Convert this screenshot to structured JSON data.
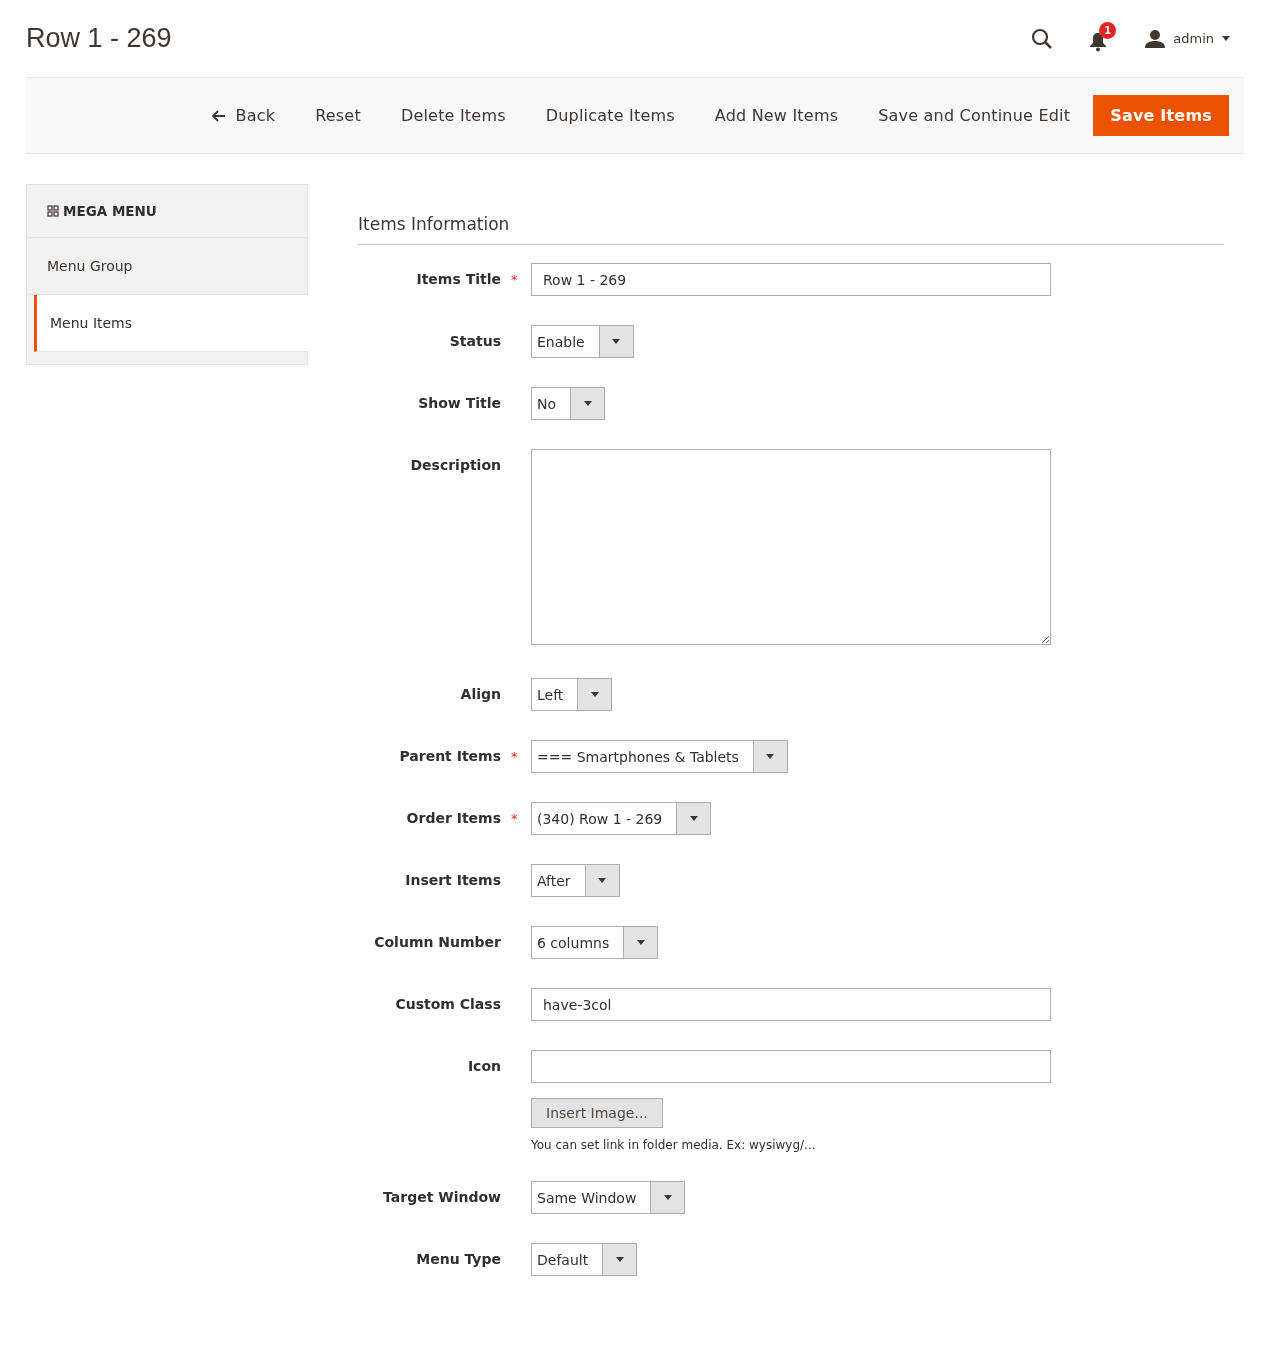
{
  "page_title": "Row 1 - 269",
  "header": {
    "notifications": "1",
    "user": "admin"
  },
  "actions": [
    {
      "label": "Back",
      "kind": "back"
    },
    {
      "label": "Reset",
      "kind": "plain"
    },
    {
      "label": "Delete Items",
      "kind": "plain"
    },
    {
      "label": "Duplicate Items",
      "kind": "plain"
    },
    {
      "label": "Add New Items",
      "kind": "plain"
    },
    {
      "label": "Save and Continue Edit",
      "kind": "plain"
    },
    {
      "label": "Save Items",
      "kind": "primary"
    }
  ],
  "sidebar": {
    "title": "MEGA MENU",
    "items": [
      {
        "label": "Menu Group",
        "selected": false
      },
      {
        "label": "Menu Items",
        "selected": true
      }
    ]
  },
  "section_title": "Items Information",
  "fields": [
    {
      "label": "Items Title",
      "required_mark": "*",
      "kind": "text",
      "value": "Row 1 - 269"
    },
    {
      "label": "Status",
      "kind": "select",
      "value": "Enable"
    },
    {
      "label": "Show Title",
      "kind": "select",
      "value": "No"
    },
    {
      "label": "Description",
      "kind": "textarea"
    },
    {
      "label": "Align",
      "kind": "select",
      "value": "Left"
    },
    {
      "label": "Parent Items",
      "required_mark": "*",
      "kind": "select",
      "value": "=== Smartphones & Tablets"
    },
    {
      "label": "Order Items",
      "required_mark": "*",
      "kind": "select",
      "value": "(340) Row 1 - 269"
    },
    {
      "label": "Insert Items",
      "kind": "select",
      "value": "After"
    },
    {
      "label": "Column Number",
      "kind": "select",
      "value": "6 columns"
    },
    {
      "label": "Custom Class",
      "kind": "text",
      "value": "have-3col"
    },
    {
      "label": "Icon",
      "kind": "image",
      "button": "Insert Image...",
      "note": "You can set link in folder media. Ex: wysiwyg/..."
    },
    {
      "label": "Target Window",
      "kind": "select",
      "value": "Same Window"
    },
    {
      "label": "Menu Type",
      "kind": "select",
      "value": "Default"
    }
  ]
}
